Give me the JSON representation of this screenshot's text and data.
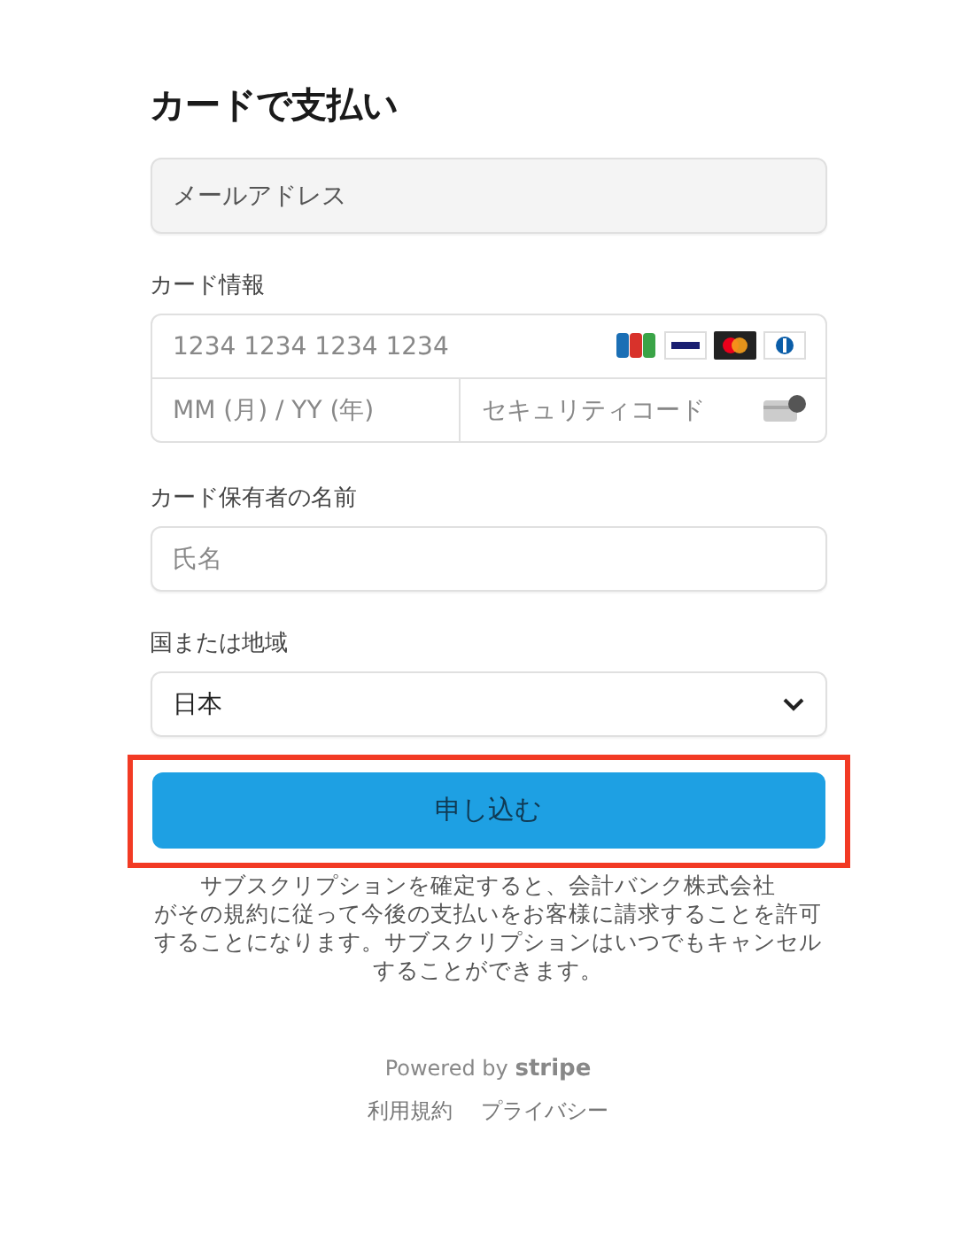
{
  "title": "カードで支払い",
  "email": {
    "placeholder": "メールアドレス"
  },
  "card": {
    "label": "カード情報",
    "number_placeholder": "1234 1234 1234 1234",
    "expiry_placeholder": "MM (月) / YY (年)",
    "cvc_placeholder": "セキュリティコード"
  },
  "cardholder": {
    "label": "カード保有者の名前",
    "placeholder": "氏名"
  },
  "country": {
    "label": "国または地域",
    "value": "日本"
  },
  "submit": {
    "label": "申し込む",
    "highlighted": true
  },
  "terms_lines": [
    "サブスクリプションを確定すると、会計バンク株式会社",
    "がその規約に従って今後の支払いをお客様に請求することを許可",
    "することになります。サブスクリプションはいつでもキャンセル",
    "することができます。"
  ],
  "footer": {
    "powered_by": "Powered by",
    "brand": "stripe",
    "links": [
      "利用規約",
      "プライバシー"
    ]
  }
}
